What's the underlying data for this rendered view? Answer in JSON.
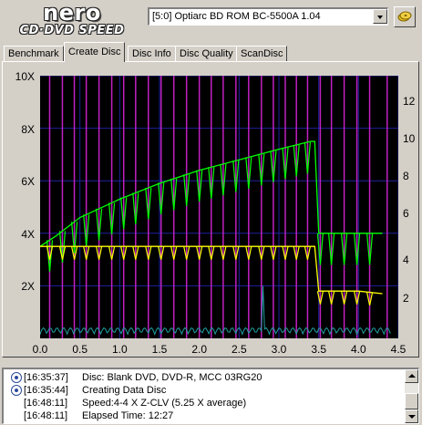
{
  "logo": {
    "brand": "nero",
    "product": "CD·DVD SPEED"
  },
  "drive": {
    "selected": "[5:0]  Optiarc BD ROM BC-5500A 1.04"
  },
  "tabs": [
    {
      "label": "Benchmark",
      "active": false
    },
    {
      "label": "Create Disc",
      "active": true
    },
    {
      "label": "Disc Info",
      "active": false
    },
    {
      "label": "Disc Quality",
      "active": false
    },
    {
      "label": "ScanDisc",
      "active": false
    }
  ],
  "chart_data": {
    "type": "line",
    "x_ticks": [
      "0.0",
      "0.5",
      "1.0",
      "1.5",
      "2.0",
      "2.5",
      "3.0",
      "3.5",
      "4.0",
      "4.5"
    ],
    "y_left_ticks": [
      "10X",
      "8X",
      "6X",
      "4X",
      "2X"
    ],
    "y_right_ticks": [
      "12",
      "10",
      "8",
      "6",
      "4",
      "2"
    ],
    "xlim": [
      0,
      4.5
    ],
    "ylim_left": [
      0,
      10
    ],
    "ylim_right": [
      0,
      14
    ],
    "series": [
      {
        "color": "#00ff00",
        "x": [
          0.0,
          0.2,
          0.5,
          1.0,
          1.5,
          2.0,
          2.5,
          3.0,
          3.4,
          3.45,
          3.5,
          4.0,
          4.3
        ],
        "values": [
          3.5,
          3.9,
          4.6,
          5.3,
          5.9,
          6.4,
          6.8,
          7.2,
          7.5,
          7.5,
          4.0,
          4.0,
          4.0
        ]
      },
      {
        "color": "#ffff00",
        "x": [
          0.0,
          0.5,
          1.0,
          1.5,
          2.0,
          2.5,
          3.0,
          3.45,
          3.5,
          4.0,
          4.3
        ],
        "values": [
          3.5,
          3.5,
          3.5,
          3.5,
          3.5,
          3.5,
          3.5,
          3.5,
          1.8,
          1.8,
          1.7
        ]
      }
    ],
    "grid": true,
    "grid_color": "#2020a0",
    "spike_color": "#c020c0",
    "noise_color": "#20a0a0"
  },
  "log": {
    "lines": [
      {
        "time": "[16:35:37]",
        "message": "Disc: Blank DVD, DVD-R, MCC 03RG20",
        "icon": "disc-info-icon"
      },
      {
        "time": "[16:35:44]",
        "message": "Creating Data Disc",
        "icon": "disc-info-icon"
      },
      {
        "time": "[16:48:11]",
        "message": "Speed:4-4 X Z-CLV (5.25 X average)",
        "icon": ""
      },
      {
        "time": "[16:48:11]",
        "message": "Elapsed Time: 12:27",
        "icon": ""
      }
    ]
  }
}
